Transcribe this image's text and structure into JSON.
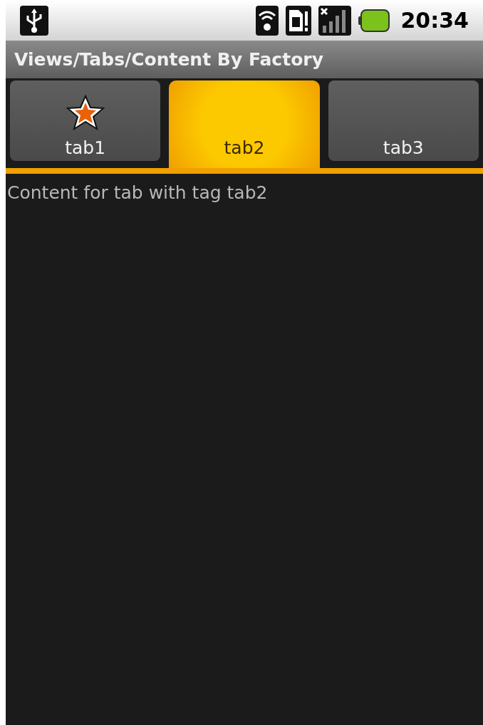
{
  "status_bar": {
    "time": "20:34"
  },
  "title_bar": {
    "title": "Views/Tabs/Content By Factory"
  },
  "tabs": [
    {
      "label": "tab1",
      "selected": false,
      "kind": "icon"
    },
    {
      "label": "tab2",
      "selected": true,
      "kind": "text"
    },
    {
      "label": "tab3",
      "selected": false,
      "kind": "text"
    }
  ],
  "content": {
    "text": "Content for tab with tag tab2"
  }
}
